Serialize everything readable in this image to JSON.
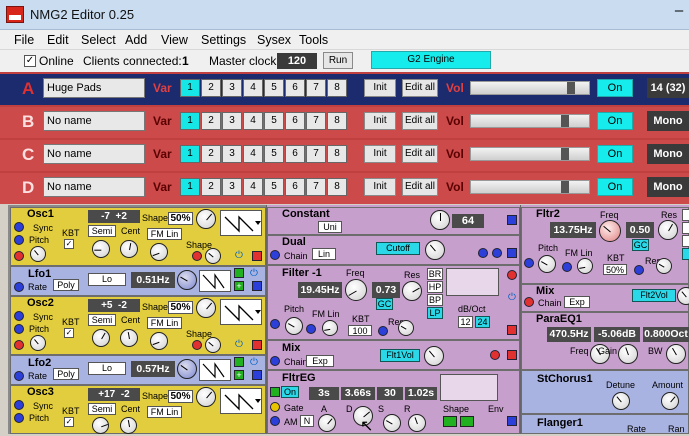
{
  "window": {
    "title": "NMG2 Editor 0.25",
    "minimize_glyph": "–"
  },
  "menu": [
    "File",
    "Edit",
    "Select",
    "Add",
    "View",
    "Settings",
    "Sysex",
    "Tools"
  ],
  "toolbar": {
    "online_check": "✓",
    "online_label": "Online",
    "clients_label": "Clients connected:",
    "clients_value": "1",
    "master_clock_label": "Master clock",
    "master_clock_value": "120",
    "run_label": "Run",
    "engine_label": "G2 Engine"
  },
  "slots": [
    {
      "letter": "A",
      "name": "Huge Pads",
      "var_label": "Var",
      "vars": [
        "1",
        "2",
        "3",
        "4",
        "5",
        "6",
        "7",
        "8"
      ],
      "selected_var": 1,
      "init": "Init",
      "edit_all": "Edit all",
      "vol_label": "Vol",
      "vol_level": 0.87,
      "on": "On",
      "voices": "14 (32)",
      "color": "#1c2a6e"
    },
    {
      "letter": "B",
      "name": "No name",
      "var_label": "Var",
      "vars": [
        "1",
        "2",
        "3",
        "4",
        "5",
        "6",
        "7",
        "8"
      ],
      "selected_var": 1,
      "init": "Init",
      "edit_all": "Edit all",
      "vol_label": "Vol",
      "vol_level": 0.82,
      "on": "On",
      "voices": "Mono",
      "color": "#cc4a4a"
    },
    {
      "letter": "C",
      "name": "No name",
      "var_label": "Var",
      "vars": [
        "1",
        "2",
        "3",
        "4",
        "5",
        "6",
        "7",
        "8"
      ],
      "selected_var": 1,
      "init": "Init",
      "edit_all": "Edit all",
      "vol_label": "Vol",
      "vol_level": 0.82,
      "on": "On",
      "voices": "Mono",
      "color": "#cc4a4a"
    },
    {
      "letter": "D",
      "name": "No name",
      "var_label": "Var",
      "vars": [
        "1",
        "2",
        "3",
        "4",
        "5",
        "6",
        "7",
        "8"
      ],
      "selected_var": 1,
      "init": "Init",
      "edit_all": "Edit all",
      "vol_label": "Vol",
      "vol_level": 0.82,
      "on": "On",
      "voices": "Mono",
      "color": "#cc4a4a"
    }
  ],
  "colors": {
    "yellow": "#e2cd3f",
    "blue_mod": "#a9b3e2",
    "purple": "#c79fcc",
    "cyan": "#16ecec",
    "red_slot": "#cc4a4a",
    "navy_slot": "#1c2a6e"
  },
  "col1": {
    "osc1": {
      "name": "Osc1",
      "sync": "Sync",
      "pitch": "Pitch",
      "coarse": "-7",
      "fine": "+2",
      "shape_label": "Shape",
      "shape_value": "50%",
      "kbt": "KBT",
      "semi": "Semi",
      "cent": "Cent",
      "fm_lin": "FM Lin",
      "shape2": "Shape"
    },
    "lfo1": {
      "name": "Lfo1",
      "rate": "Rate",
      "lo": "Lo",
      "poly": "Poly",
      "freq": "0.51Hz"
    },
    "osc2": {
      "name": "Osc2",
      "sync": "Sync",
      "pitch": "Pitch",
      "coarse": "+5",
      "fine": "-2",
      "shape_label": "Shape",
      "shape_value": "50%",
      "kbt": "KBT",
      "semi": "Semi",
      "cent": "Cent",
      "fm_lin": "FM Lin",
      "shape2": "Shape"
    },
    "lfo2": {
      "name": "Lfo2",
      "rate": "Rate",
      "lo": "Lo",
      "poly": "Poly",
      "freq": "0.57Hz"
    },
    "osc3": {
      "name": "Osc3",
      "sync": "Sync",
      "pitch": "Pitch",
      "coarse": "+17",
      "fine": "-2",
      "shape_label": "Shape",
      "shape_value": "50%",
      "kbt": "KBT",
      "semi": "Semi",
      "cent": "Cent",
      "fm_lin": "FM Lin"
    }
  },
  "col2": {
    "constant": {
      "name": "Constant",
      "uni": "Uni",
      "value": "64"
    },
    "dual": {
      "name": "Dual",
      "chain": "Chain",
      "lin": "Lin",
      "cutoff": "Cutoff"
    },
    "filter": {
      "name": "Filter -1",
      "freq_label": "Freq",
      "freq": "19.45Hz",
      "res_label": "Res",
      "res": "0.73",
      "gc": "GC",
      "modes": [
        "BR",
        "HP",
        "BP",
        "LP"
      ],
      "pitch": "Pitch",
      "fm_lin": "FM Lin",
      "kbt": "KBT",
      "kbt_value": "100",
      "res2": "Res",
      "db_oct": "dB/Oct",
      "db12": "12",
      "db24": "24"
    },
    "mix": {
      "name": "Mix",
      "chain": "Chain",
      "exp": "Exp",
      "flt1vol": "Flt1Vol"
    },
    "fltreg": {
      "name": "FltrEG",
      "on": "On",
      "a": "3s",
      "d": "3.66s",
      "s": "30",
      "r": "1.02s",
      "gate": "Gate",
      "am": "AM",
      "n": "N",
      "a_lbl": "A",
      "d_lbl": "D",
      "s_lbl": "S",
      "r_lbl": "R",
      "shape": "Shape",
      "env": "Env"
    }
  },
  "col3": {
    "fltr2": {
      "name": "Fltr2",
      "freq_label": "Freq",
      "freq": "13.75Hz",
      "res_label": "Res",
      "res": "0.50",
      "gc": "GC",
      "pitch": "Pitch",
      "fm_lin": "FM Lin",
      "kbt": "KBT",
      "kbt_value": "50%",
      "res2": "Res"
    },
    "mix": {
      "name": "Mix",
      "chain": "Chain",
      "exp": "Exp",
      "flt2vol": "Flt2Vol"
    },
    "paraeq": {
      "name": "ParaEQ1",
      "freq": "470.5Hz",
      "gain": "-5.06dB",
      "bw": "0.800Oct",
      "freq_lbl": "Freq",
      "gain_lbl": "Gain",
      "bw_lbl": "BW"
    },
    "chorus": {
      "name": "StChorus1",
      "detune": "Detune",
      "amount": "Amount"
    },
    "flanger": {
      "name": "Flanger1",
      "rate": "Rate",
      "range": "Ran"
    }
  }
}
